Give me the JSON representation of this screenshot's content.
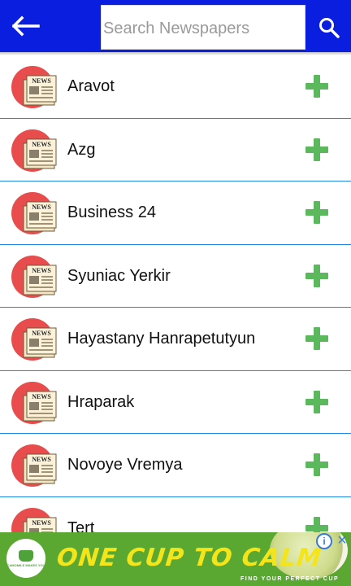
{
  "header": {
    "search_placeholder": "Search Newspapers",
    "back_icon": "arrow-left-icon",
    "search_icon": "magnifier-icon",
    "bar_color": "#0a1ee0"
  },
  "newspapers": [
    {
      "name": "Aravot"
    },
    {
      "name": "Azg"
    },
    {
      "name": "Business 24"
    },
    {
      "name": "Syuniac Yerkir"
    },
    {
      "name": "Hayastany Hanrapetutyun"
    },
    {
      "name": "Hraparak"
    },
    {
      "name": "Novoye Vremya"
    },
    {
      "name": "Tert"
    }
  ],
  "icons": {
    "logo": "newspaper-icon",
    "logo_text": "NEWS",
    "add": "plus-icon",
    "add_color": "#5cb85c",
    "divider_color": "#1e88e5"
  },
  "ad": {
    "headline": "ONE CUP TO CALM",
    "subline": "FIND YOUR PERFECT CUP",
    "brand_small": "CAMOMILE MAKES YOU",
    "background": "#5aa832"
  }
}
